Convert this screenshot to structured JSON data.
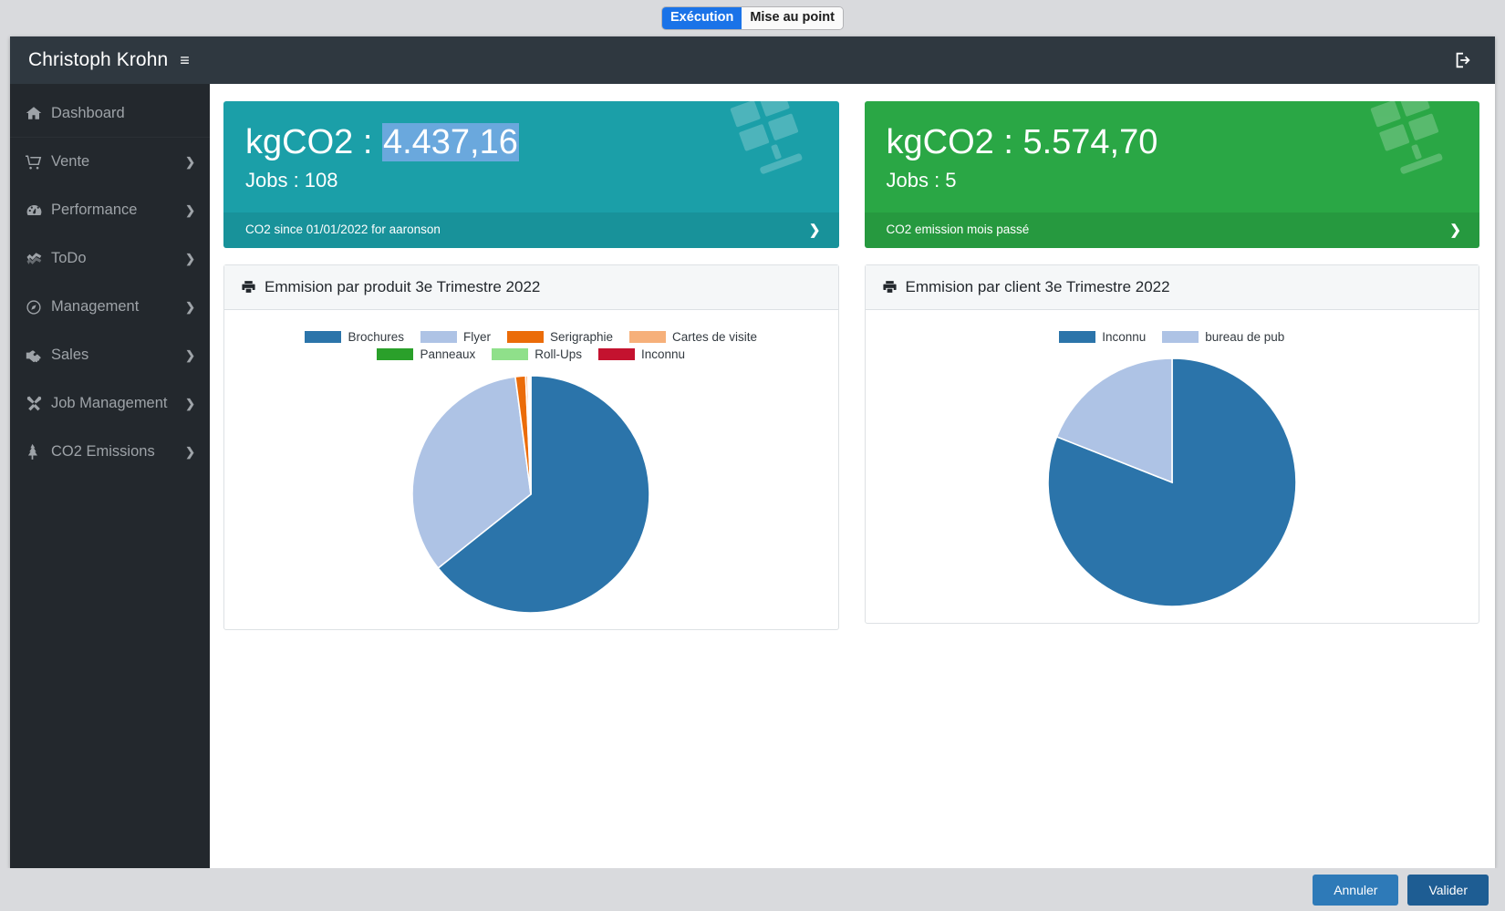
{
  "browser_mode": {
    "active_label": "Exécution",
    "inactive_label": "Mise au point",
    "active_color": "#1a73e8"
  },
  "navbar": {
    "brand": "Christoph Krohn",
    "menu_icon": "hamburger-icon",
    "logout_icon": "sign-out-icon"
  },
  "sidebar": {
    "items": [
      {
        "label": "Dashboard",
        "icon": "home-icon",
        "has_caret": false
      },
      {
        "label": "Vente",
        "icon": "cart-icon",
        "has_caret": true
      },
      {
        "label": "Performance",
        "icon": "tachometer-icon",
        "has_caret": true
      },
      {
        "label": "ToDo",
        "icon": "tasks-icon",
        "has_caret": true
      },
      {
        "label": "Management",
        "icon": "compass-icon",
        "has_caret": true
      },
      {
        "label": "Sales",
        "icon": "handshake-icon",
        "has_caret": true
      },
      {
        "label": "Job Management",
        "icon": "tools-icon",
        "has_caret": true
      },
      {
        "label": "CO2 Emissions",
        "icon": "tree-icon",
        "has_caret": true
      }
    ],
    "caret_glyph": "❯"
  },
  "kpi_cards": [
    {
      "value_prefix": "kgCO2 : ",
      "value": "4.437,16",
      "value_selected": true,
      "jobs_label": "Jobs : 108",
      "footer": "CO2 since 01/01/2022 for aaronson",
      "color": "#1b9fa8",
      "chevron": "❯",
      "art_icon": "solar-panel-icon"
    },
    {
      "value_prefix": "kgCO2 : ",
      "value": "5.574,70",
      "value_selected": false,
      "jobs_label": "Jobs : 5",
      "footer": "CO2 emission mois passé",
      "color": "#2aa745",
      "chevron": "❯",
      "art_icon": "solar-panel-icon"
    }
  ],
  "panels": [
    {
      "title": "Emmision par produit 3e Trimestre 2022",
      "icon": "print-icon"
    },
    {
      "title": "Emmision par client 3e Trimestre 2022",
      "icon": "print-icon"
    }
  ],
  "footer_actions": {
    "cancel_label": "Annuler",
    "validate_label": "Valider"
  },
  "chart_data": [
    {
      "type": "pie",
      "title": "Emmision par produit 3e Trimestre 2022",
      "legend_position": "top",
      "start_angle_deg": 0,
      "direction": "clockwise",
      "categories": [
        "Brochures",
        "Flyer",
        "Serigraphie",
        "Cartes de visite",
        "Panneaux",
        "Roll-Ups",
        "Inconnu"
      ],
      "colors": [
        "#2b74aa",
        "#aec3e5",
        "#eb6c09",
        "#f6b07a",
        "#2aa02a",
        "#8fe08a",
        "#c4122f"
      ],
      "values": [
        64.3,
        33.6,
        1.4,
        0.3,
        0.2,
        0.1,
        0.1
      ],
      "unit": "%"
    },
    {
      "type": "pie",
      "title": "Emmision par client 3e Trimestre 2022",
      "legend_position": "top",
      "start_angle_deg": 0,
      "direction": "clockwise",
      "categories": [
        "Inconnu",
        "bureau de pub"
      ],
      "colors": [
        "#2b74aa",
        "#aec3e5"
      ],
      "values": [
        81.0,
        19.0
      ],
      "unit": "%"
    }
  ]
}
